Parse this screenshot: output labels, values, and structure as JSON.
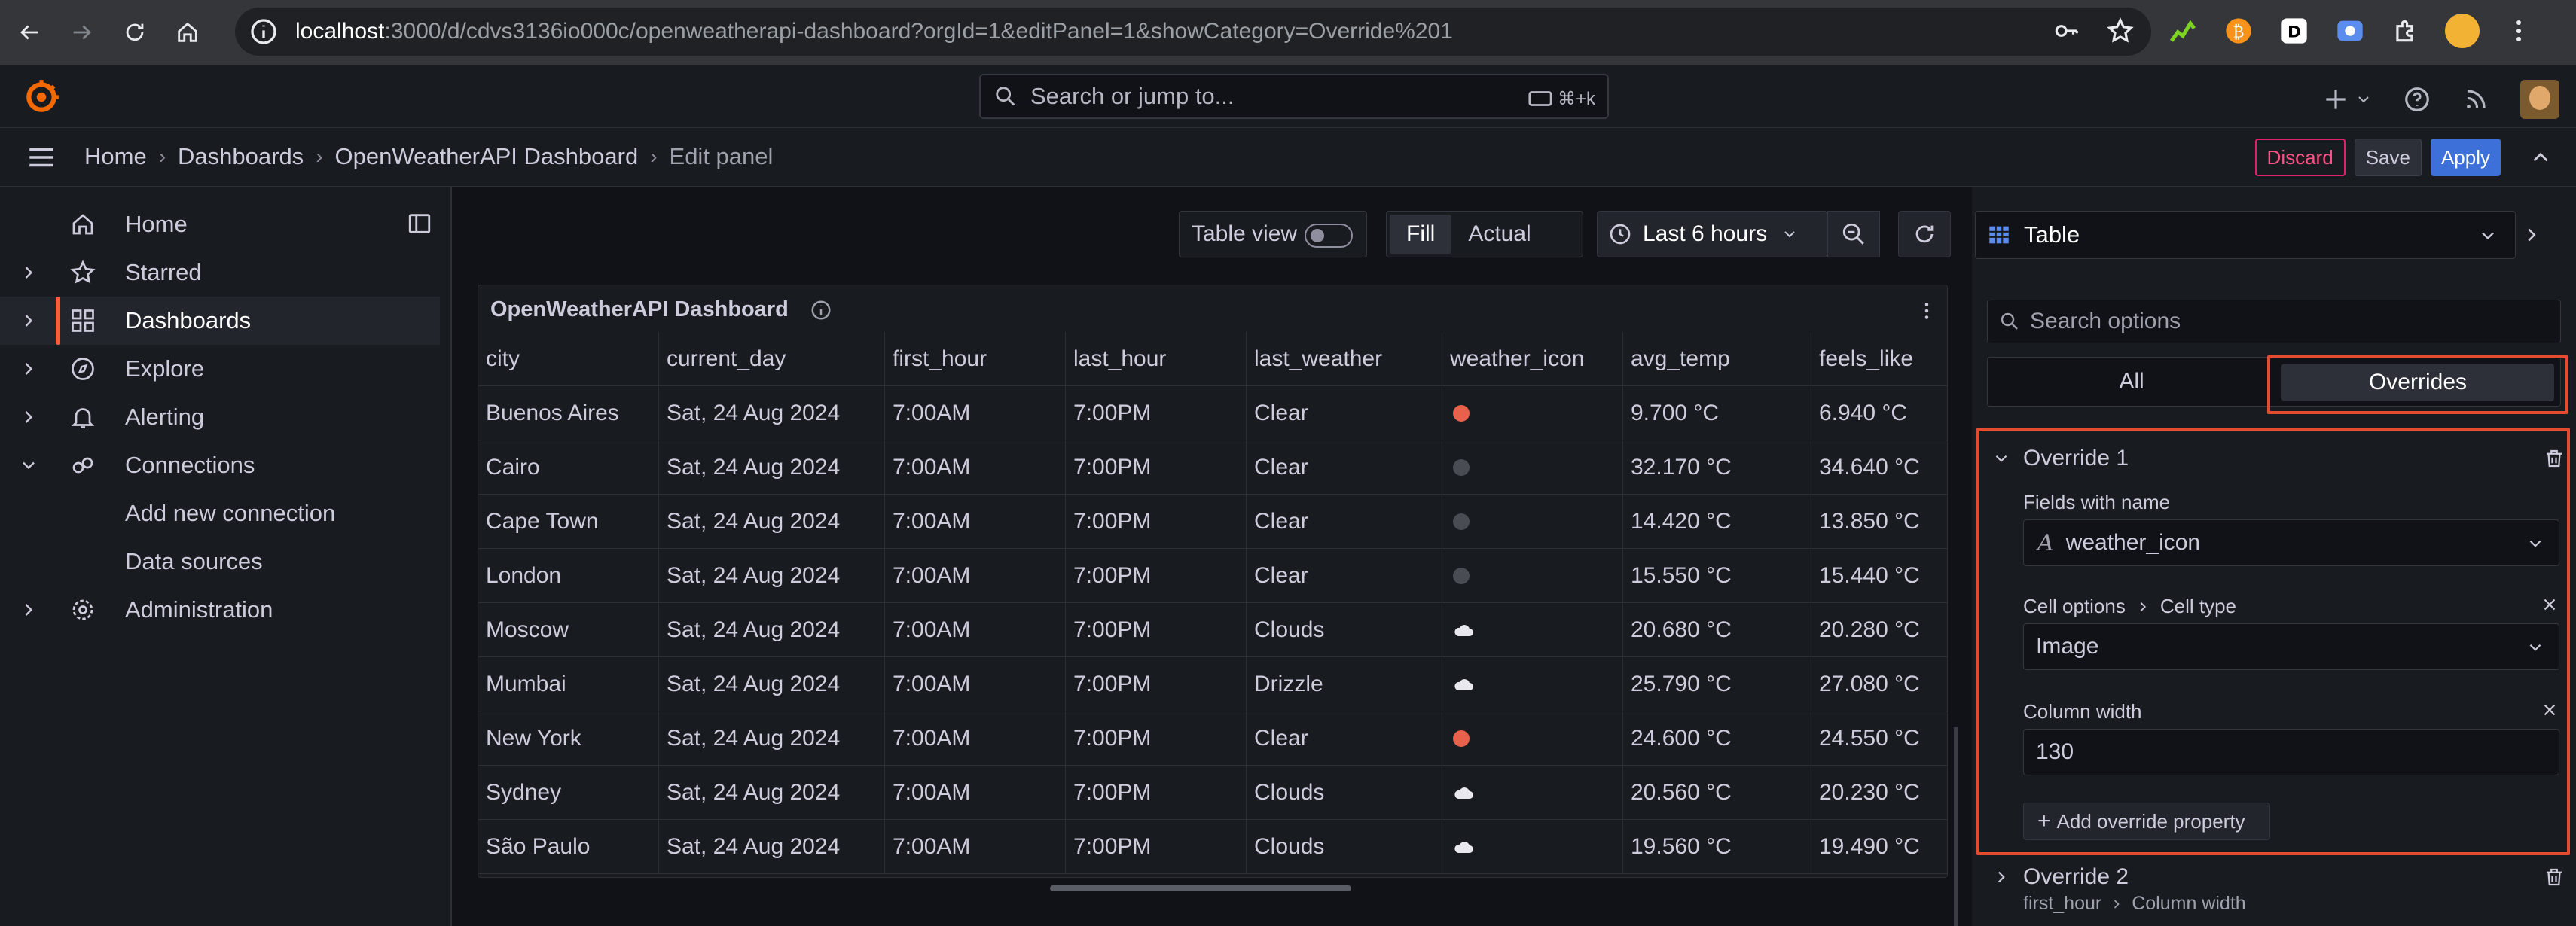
{
  "browser": {
    "url_host": "localhost",
    "url_rest": ":3000/d/cdvs3136io000c/openweatherapi-dashboard?orgId=1&editPanel=1&showCategory=Override%201"
  },
  "topbar": {
    "search_placeholder": "Search or jump to...",
    "search_shortcut": "⌘+k"
  },
  "breadcrumb": {
    "items": [
      "Home",
      "Dashboards",
      "OpenWeatherAPI Dashboard"
    ],
    "current": "Edit panel",
    "separator": "›"
  },
  "actions": {
    "discard": "Discard",
    "save": "Save",
    "apply": "Apply"
  },
  "sidebar": {
    "items": [
      {
        "label": "Home"
      },
      {
        "label": "Starred"
      },
      {
        "label": "Dashboards"
      },
      {
        "label": "Explore"
      },
      {
        "label": "Alerting"
      },
      {
        "label": "Connections"
      },
      {
        "label": "Add new connection"
      },
      {
        "label": "Data sources"
      },
      {
        "label": "Administration"
      }
    ]
  },
  "controls": {
    "table_view": "Table view",
    "fill": "Fill",
    "actual": "Actual",
    "time_range": "Last 6 hours"
  },
  "panel": {
    "title": "OpenWeatherAPI Dashboard",
    "columns": [
      "city",
      "current_day",
      "first_hour",
      "last_hour",
      "last_weather",
      "weather_icon",
      "avg_temp",
      "feels_like"
    ],
    "rows": [
      {
        "city": "Buenos Aires",
        "day": "Sat, 24 Aug 2024",
        "first": "7:00AM",
        "last": "7:00PM",
        "weather": "Clear",
        "icon": "sun",
        "avg": "9.700 °C",
        "feels": "6.940 °C"
      },
      {
        "city": "Cairo",
        "day": "Sat, 24 Aug 2024",
        "first": "7:00AM",
        "last": "7:00PM",
        "weather": "Clear",
        "icon": "moon",
        "avg": "32.170 °C",
        "feels": "34.640 °C"
      },
      {
        "city": "Cape Town",
        "day": "Sat, 24 Aug 2024",
        "first": "7:00AM",
        "last": "7:00PM",
        "weather": "Clear",
        "icon": "moon",
        "avg": "14.420 °C",
        "feels": "13.850 °C"
      },
      {
        "city": "London",
        "day": "Sat, 24 Aug 2024",
        "first": "7:00AM",
        "last": "7:00PM",
        "weather": "Clear",
        "icon": "moon",
        "avg": "15.550 °C",
        "feels": "15.440 °C"
      },
      {
        "city": "Moscow",
        "day": "Sat, 24 Aug 2024",
        "first": "7:00AM",
        "last": "7:00PM",
        "weather": "Clouds",
        "icon": "cloud",
        "avg": "20.680 °C",
        "feels": "20.280 °C"
      },
      {
        "city": "Mumbai",
        "day": "Sat, 24 Aug 2024",
        "first": "7:00AM",
        "last": "7:00PM",
        "weather": "Drizzle",
        "icon": "cloud",
        "avg": "25.790 °C",
        "feels": "27.080 °C"
      },
      {
        "city": "New York",
        "day": "Sat, 24 Aug 2024",
        "first": "7:00AM",
        "last": "7:00PM",
        "weather": "Clear",
        "icon": "sun",
        "avg": "24.600 °C",
        "feels": "24.550 °C"
      },
      {
        "city": "Sydney",
        "day": "Sat, 24 Aug 2024",
        "first": "7:00AM",
        "last": "7:00PM",
        "weather": "Clouds",
        "icon": "cloud",
        "avg": "20.560 °C",
        "feels": "20.230 °C"
      },
      {
        "city": "São Paulo",
        "day": "Sat, 24 Aug 2024",
        "first": "7:00AM",
        "last": "7:00PM",
        "weather": "Clouds",
        "icon": "cloud",
        "avg": "19.560 °C",
        "feels": "19.490 °C"
      }
    ]
  },
  "options": {
    "visualization": "Table",
    "search_placeholder": "Search options",
    "tab_all": "All",
    "tab_overrides": "Overrides",
    "override1": {
      "title": "Override 1",
      "fields_label": "Fields with name",
      "fields_value": "weather_icon",
      "cell_options": "Cell options",
      "cell_type": "Cell type",
      "cell_type_value": "Image",
      "column_width_label": "Column width",
      "column_width_value": "130",
      "add_property": "Add override property"
    },
    "override2": {
      "title": "Override 2",
      "field": "first_hour",
      "property": "Column width"
    }
  },
  "colors": {
    "accent_orange": "#f55f3e",
    "highlight": "#e44b2f",
    "apply_blue": "#3d71d9",
    "discard_pink": "#e0226e",
    "sun": "#e8614b",
    "moon": "#4a4c54"
  }
}
